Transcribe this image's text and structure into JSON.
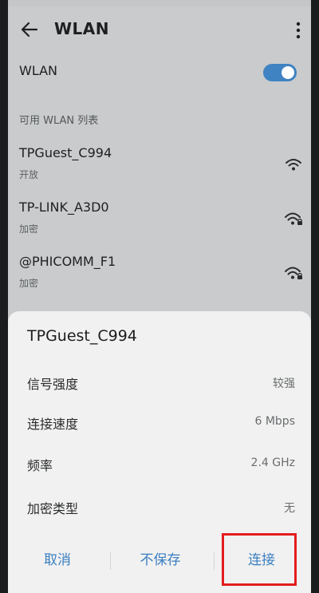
{
  "app_bar": {
    "title": "WLAN",
    "back_icon": "arrow-left-icon",
    "more_icon": "more-vertical-icon"
  },
  "wlan_toggle": {
    "label": "WLAN",
    "state": "on",
    "color": "#3f83c2"
  },
  "network_list": {
    "header": "可用 WLAN 列表",
    "items": [
      {
        "name": "TPGuest_C994",
        "status": "开放",
        "icon": "wifi-open-icon"
      },
      {
        "name": "TP-LINK_A3D0",
        "status": "加密",
        "icon": "wifi-locked-icon"
      },
      {
        "name": "@PHICOMM_F1",
        "status": "加密",
        "icon": "wifi-locked-icon"
      }
    ]
  },
  "dialog": {
    "title": "TPGuest_C994",
    "details": [
      {
        "label": "信号强度",
        "value": "较强"
      },
      {
        "label": "连接速度",
        "value": "6 Mbps"
      },
      {
        "label": "频率",
        "value": "2.4 GHz"
      },
      {
        "label": "加密类型",
        "value": "无"
      }
    ],
    "buttons": {
      "cancel": "取消",
      "forget": "不保存",
      "connect": "连接"
    },
    "accent_color": "#3a7fc1",
    "highlight_color": "#e41d1d"
  }
}
